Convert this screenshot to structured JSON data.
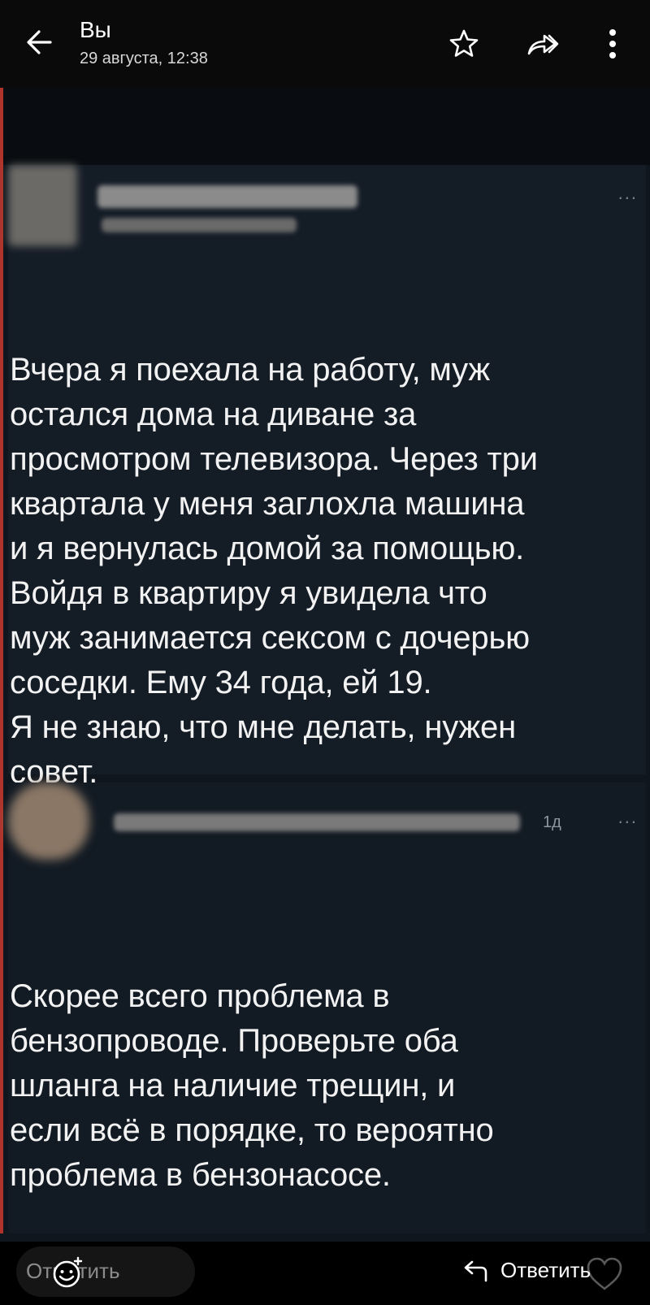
{
  "header": {
    "title": "Вы",
    "subtitle": "29 августа, 12:38",
    "back_icon": "arrow-left-icon",
    "favorite_icon": "star-icon",
    "share_icon": "forward-arrow-icon",
    "more_icon": "more-vertical-icon"
  },
  "photo": {
    "post1": {
      "text": "Вчера я поехала на работу, муж\nостался дома на диване за\nпросмотром телевизора. Через три\nквартала у меня заглохла машина\nи я вернулась домой за помощью.\nВойдя в квартиру я увидела что\nмуж занимается сексом с дочерью\nсоседки. Ему 34 года, ей 19.\nЯ не знаю, что мне делать, нужен\nсовет.",
      "menu": "..."
    },
    "post2": {
      "time": "1д",
      "menu": "...",
      "text": "Скорее всего проблема в\nбензопроводе. Проверьте оба\nшланга на наличие трещин, и\nесли всё в порядке, то вероятно\nпроблема в бензонасосе."
    }
  },
  "footer": {
    "comment_placeholder": "Отметить",
    "reply_label": "Ответить",
    "emoji_icon": "emoji-add-icon",
    "reply_icon": "reply-icon",
    "like_icon": "heart-icon"
  },
  "colors": {
    "bar_bg": "#0a0a0a",
    "photo_bg": "#141c26",
    "text": "#f2f2f2",
    "accent_red": "#b0342c"
  }
}
